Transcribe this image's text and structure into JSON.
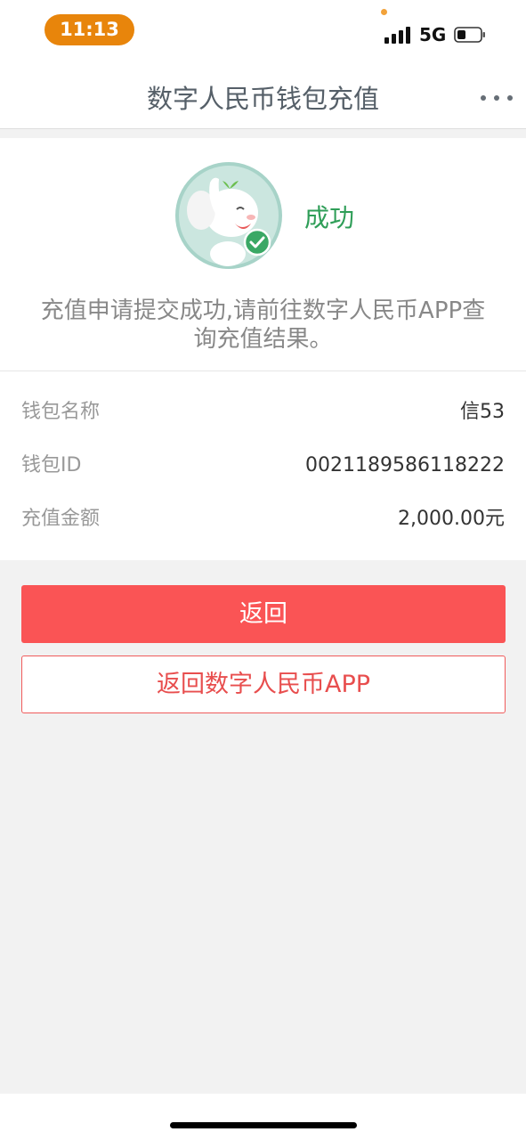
{
  "status_bar": {
    "time": "11:13",
    "network": "5G",
    "accent_color": "#e8850b"
  },
  "nav": {
    "title": "数字人民币钱包充值",
    "more_icon": "more-dots-icon"
  },
  "result": {
    "mascot_icon": "elephant-mascot-success-icon",
    "status": "成功",
    "status_color": "#2f9e58",
    "message_line1": "充值申请提交成功,请前往数字人民币APP查",
    "message_line2": "询充值结果。"
  },
  "details": {
    "rows": [
      {
        "label": "钱包名称",
        "value": "信53"
      },
      {
        "label": "钱包ID",
        "value": "0021189586118222"
      },
      {
        "label": "充值金额",
        "value": "2,000.00元"
      }
    ]
  },
  "actions": {
    "back_label": "返回",
    "back_to_app_label": "返回数字人民币APP",
    "primary_color": "#fa5455"
  }
}
